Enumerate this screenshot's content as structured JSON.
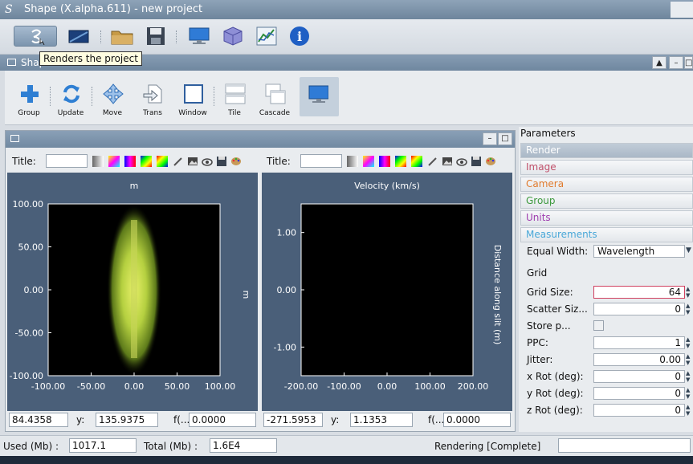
{
  "window": {
    "title": "Shape (X.alpha.611) - new project"
  },
  "tooltip": "Renders the project",
  "panel": {
    "title": "Shape Modeler"
  },
  "shape_toolbar": {
    "group": "Group",
    "update": "Update",
    "move": "Move",
    "trans": "Trans",
    "window": "Window",
    "tile": "Tile",
    "cascade": "Cascade"
  },
  "plots": [
    {
      "title_label": "Title:",
      "title_value": "",
      "heading": "m",
      "right_label": "m",
      "x_ticks": [
        "-100.00",
        "-50.00",
        "0.00",
        "50.00",
        "100.00"
      ],
      "y_ticks": [
        "100.00",
        "50.00",
        "0.00",
        "-50.00",
        "-100.00"
      ],
      "coords": {
        "x": "84.4358",
        "y_label": "y:",
        "y": "135.9375",
        "f_label": "f(...",
        "f": "0.0000"
      }
    },
    {
      "title_label": "Title:",
      "title_value": "",
      "heading": "Velocity (km/s)",
      "right_label": "Distance along slit (m)",
      "x_ticks": [
        "-200.00",
        "-100.00",
        "0.00",
        "100.00",
        "200.00"
      ],
      "y_ticks": [
        "1.00",
        "0.00",
        "-1.00"
      ],
      "coords": {
        "x": "-271.5953",
        "y_label": "y:",
        "y": "1.1353",
        "f_label": "f(...",
        "f": "0.0000"
      }
    }
  ],
  "parameters": {
    "title": "Parameters",
    "tabs": [
      {
        "label": "Render",
        "color": "#ffffff"
      },
      {
        "label": "Image",
        "color": "#c0506a"
      },
      {
        "label": "Camera",
        "color": "#e07b2e"
      },
      {
        "label": "Group",
        "color": "#3f9a3f"
      },
      {
        "label": "Units",
        "color": "#a040b0"
      },
      {
        "label": "Measurements",
        "color": "#4aa8d8"
      }
    ],
    "equal_width_label": "Equal Width:",
    "equal_width_value": "Wavelength",
    "grid_heading": "Grid",
    "fields": [
      {
        "label": "Grid Size:",
        "value": "64"
      },
      {
        "label": "Scatter Siz...",
        "value": "0"
      },
      {
        "label": "Store p...",
        "value": ""
      },
      {
        "label": "PPC:",
        "value": "1"
      },
      {
        "label": "Jitter:",
        "value": "0.00"
      },
      {
        "label": "x Rot (deg):",
        "value": "0"
      },
      {
        "label": "y Rot (deg):",
        "value": "0"
      },
      {
        "label": "z Rot (deg):",
        "value": "0"
      }
    ]
  },
  "status": {
    "used_label": "Used (Mb) :",
    "used_value": "1017.1",
    "total_label": "Total (Mb) :",
    "total_value": "1.6E4",
    "rendering": "Rendering [Complete]"
  }
}
